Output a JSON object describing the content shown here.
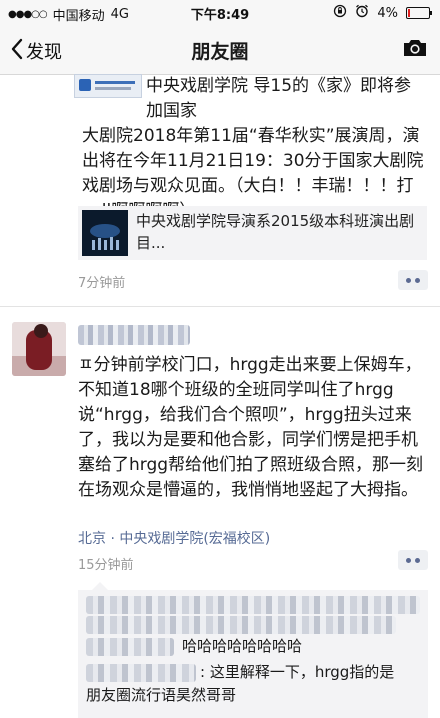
{
  "status_bar": {
    "carrier": "中国移动",
    "network": "4G",
    "time": "下午8:49",
    "battery": "4%"
  },
  "nav": {
    "back_label": "发现",
    "title": "朋友圈"
  },
  "post1": {
    "text_line1": "中央戏剧学院 导15的《家》即将参加国家",
    "text_rest": "大剧院2018年第11届“春华秋实”展演周，演出将在今年11月21日19：30分于国家大剧院戏剧场与观众见面。（大白！！丰瑞！！！打call啊啊啊啊）",
    "share_title": "中央戏剧学院导演系2015级本科班演出剧目...",
    "time": "7分钟前"
  },
  "post2": {
    "text": "ㅍ分钟前学校门口，hrgg走出来要上保姆车，不知道18哪个班级的全班同学叫住了hrgg说“hrgg，给我们合个照呗”，hrgg扭头过来了，我以为是要和他合影，同学们愣是把手机塞给了hrgg帮给他们拍了照班级合照，那一刻在场观众是懵逼的，我悄悄地竖起了大拇指。",
    "location": "北京 · 中央戏剧学院(宏福校区)",
    "time": "15分钟前",
    "comments": [
      {
        "text": "哈哈哈哈哈哈哈哈"
      },
      {
        "text": ": 这里解释一下，hrgg指的是"
      },
      {
        "text": "朋友圈流行语昊然哥哥"
      }
    ]
  },
  "colors": {
    "link_blue": "#576b95",
    "nav_bg": "#f7f7f7",
    "comment_bg": "#f3f3f5",
    "timestamp_gray": "#9a9a9a"
  },
  "icons": [
    "back-chevron-icon",
    "camera-icon",
    "alarm-icon",
    "lock-rotation-icon",
    "more-dots-icon"
  ]
}
